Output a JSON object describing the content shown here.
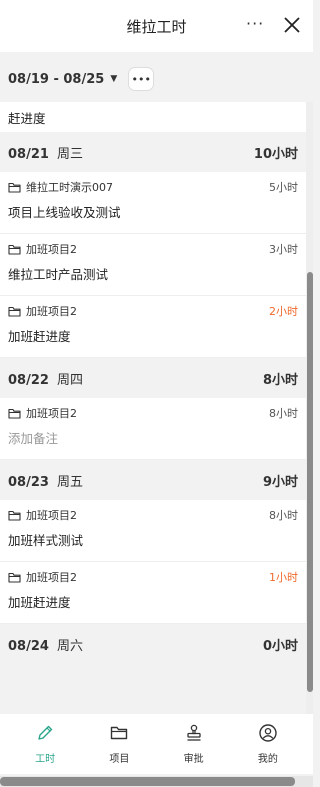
{
  "header": {
    "title": "维拉工时",
    "more": "···"
  },
  "range": {
    "label": "08/19 - 08/25",
    "caret": "▼",
    "more": "•••"
  },
  "top_note": "赶进度",
  "days": [
    {
      "date": "08/21",
      "weekday": "周三",
      "total": "10小时",
      "entries": [
        {
          "project": "维拉工时演示007",
          "hours": "5小时",
          "warn": false,
          "note": "项目上线验收及测试",
          "placeholder": false
        },
        {
          "project": "加班项目2",
          "hours": "3小时",
          "warn": false,
          "note": "维拉工时产品测试",
          "placeholder": false
        },
        {
          "project": "加班项目2",
          "hours": "2小时",
          "warn": true,
          "note": "加班赶进度",
          "placeholder": false
        }
      ]
    },
    {
      "date": "08/22",
      "weekday": "周四",
      "total": "8小时",
      "entries": [
        {
          "project": "加班项目2",
          "hours": "8小时",
          "warn": false,
          "note": "添加备注",
          "placeholder": true
        }
      ]
    },
    {
      "date": "08/23",
      "weekday": "周五",
      "total": "9小时",
      "entries": [
        {
          "project": "加班项目2",
          "hours": "8小时",
          "warn": false,
          "note": "加班样式测试",
          "placeholder": false
        },
        {
          "project": "加班项目2",
          "hours": "1小时",
          "warn": true,
          "note": "加班赶进度",
          "placeholder": false
        }
      ]
    },
    {
      "date": "08/24",
      "weekday": "周六",
      "total": "0小时",
      "entries": []
    }
  ],
  "tabs": [
    {
      "label": "工时",
      "icon": "pencil-icon",
      "active": true
    },
    {
      "label": "项目",
      "icon": "folder-icon",
      "active": false
    },
    {
      "label": "审批",
      "icon": "stamp-icon",
      "active": false
    },
    {
      "label": "我的",
      "icon": "user-circle-icon",
      "active": false
    }
  ],
  "colors": {
    "accent": "#2aa58c",
    "warn": "#f06a2b"
  }
}
